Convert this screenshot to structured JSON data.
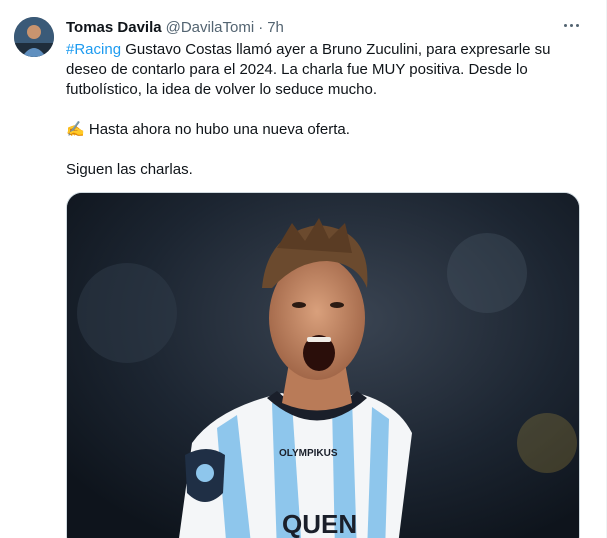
{
  "tweet": {
    "author_name": "Tomas Davila",
    "author_handle": "@DavilaTomi",
    "separator": "·",
    "timestamp": "7h",
    "hashtag": "#Racing",
    "text_line1_rest": " Gustavo Costas llamó ayer a Bruno Zuculini, para expresarle su",
    "text_line2": "deseo de contarlo para el 2024. La charla fue MUY positiva. Desde lo",
    "text_line3": "futbolístico, la idea de volver lo seduce mucho.",
    "text_para2_emoji": "✍️",
    "text_para2": " Hasta ahora no hubo una nueva oferta.",
    "text_para3": "Siguen las charlas."
  },
  "media": {
    "jersey_text": "QUEN",
    "sponsor_text": "OLYMPIKUS",
    "colors": {
      "background": "#1a2230",
      "jersey_blue": "#8ec6ec",
      "jersey_white": "#f4f6f8",
      "skin": "#c68a68",
      "hair": "#6b4a2e"
    }
  },
  "colors": {
    "text_primary": "#0f1419",
    "text_secondary": "#536471",
    "link": "#1d9bf0",
    "border": "#cfd9de"
  }
}
